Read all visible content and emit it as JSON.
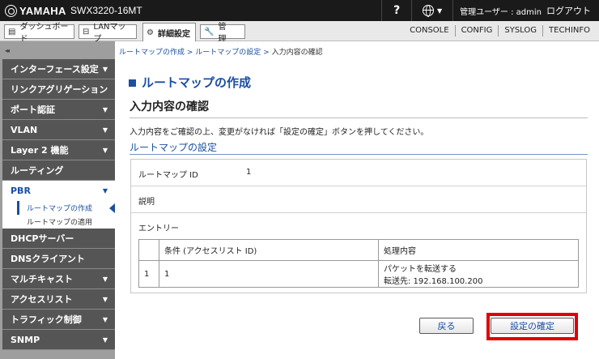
{
  "header": {
    "brand": "YAMAHA",
    "model": "SWX3220-16MT",
    "help": "?",
    "user_text": "管理ユーザー : admin",
    "logout": "ログアウト"
  },
  "nav": {
    "tabs": [
      {
        "label": "ダッシュボード",
        "icon": "dashboard-icon"
      },
      {
        "label": "LANマップ",
        "icon": "lan-map-icon"
      },
      {
        "label": "詳細設定",
        "icon": "gear-icon"
      },
      {
        "label": "管　理",
        "icon": "wrench-icon"
      }
    ],
    "links": [
      "CONSOLE",
      "CONFIG",
      "SYSLOG",
      "TECHINFO"
    ]
  },
  "sidebar": {
    "collapse": "◂◂",
    "items": [
      {
        "label": "インターフェース設定",
        "arrow": "▼"
      },
      {
        "label": "リンクアグリゲーション",
        "arrow": ""
      },
      {
        "label": "ポート認証",
        "arrow": "▼"
      },
      {
        "label": "VLAN",
        "arrow": "▼"
      },
      {
        "label": "Layer 2 機能",
        "arrow": "▼"
      },
      {
        "label": "ルーティング",
        "arrow": ""
      },
      {
        "label": "PBR",
        "arrow": "▼"
      },
      {
        "label": "DHCPサーバー",
        "arrow": ""
      },
      {
        "label": "DNSクライアント",
        "arrow": ""
      },
      {
        "label": "マルチキャスト",
        "arrow": "▼"
      },
      {
        "label": "アクセスリスト",
        "arrow": "▼"
      },
      {
        "label": "トラフィック制御",
        "arrow": "▼"
      },
      {
        "label": "SNMP",
        "arrow": "▼"
      }
    ],
    "pbr_sub": [
      "ルートマップの作成",
      "ルートマップの適用"
    ]
  },
  "breadcrumb": {
    "part1": "ルートマップの作成",
    "sep": " > ",
    "part2": "ルートマップの設定",
    "current": "入力内容の確認"
  },
  "main": {
    "title": "ルートマップの作成",
    "section": "入力内容の確認",
    "description": "入力内容をご確認の上、変更がなければ「設定の確定」ボタンを押してください。",
    "subheading": "ルートマップの設定",
    "fields": {
      "id_label": "ルートマップ ID",
      "id_value": "1",
      "desc_label": "説明",
      "entry_label": "エントリー"
    },
    "entry_table": {
      "headers": [
        "",
        "条件 (アクセスリスト ID)",
        "処理内容"
      ],
      "rows": [
        {
          "no": "1",
          "condition": "1",
          "action_line1": "パケットを転送する",
          "action_line2": "転送先: 192.168.100.200"
        }
      ]
    },
    "buttons": {
      "back": "戻る",
      "confirm": "設定の確定"
    }
  },
  "colors": {
    "accent": "#1a4fa0",
    "highlight": "#e00000",
    "topbar": "#1a1a1a",
    "sidebar_item": "#555555"
  }
}
